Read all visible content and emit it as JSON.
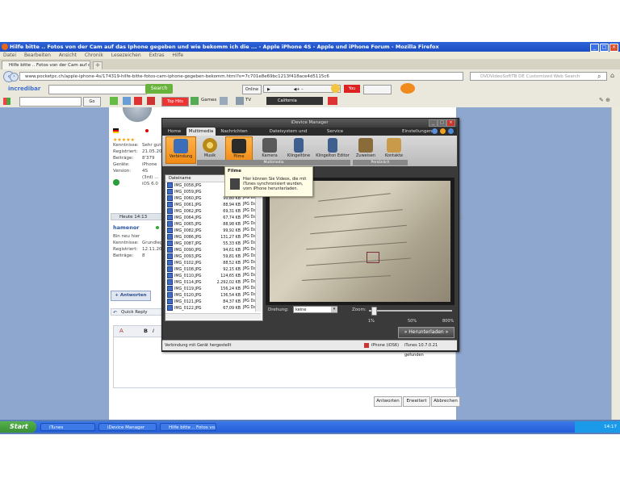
{
  "firefox": {
    "title": "Hilfe bitte .. Fotos von der Cam auf das Iphone gegeben und wie bekomm ich die ... - Apple iPhone 4S - Apple und iPhone Forum - Mozilla Firefox",
    "menu": [
      "Datei",
      "Bearbeiten",
      "Ansicht",
      "Chronik",
      "Lesezeichen",
      "Extras",
      "Hilfe"
    ],
    "tab_label": "Hilfe bitte .. Fotos von der Cam auf das Iph...",
    "url": "www.pocketpc.ch/apple-iphone-4s/174319-hilfe-bitte-fotos-cam-iphone-gegeben-bekomm.html?s=7c701e8e69bc1213f418ace4d5115c6",
    "search_placeholder": "DVDVideoSoftTB DE Customized Web Search",
    "incredibar_label": "incredibar",
    "incredibar_search": "Search",
    "toolbar_items": {
      "top": "Top Hits",
      "games": "Games",
      "tv": "TV",
      "weather": "California"
    }
  },
  "forum": {
    "profile1": {
      "rows": [
        {
          "label": "Kenntnisse:",
          "value": "Sehr gut"
        },
        {
          "label": "Registriert:",
          "value": "21.05.20"
        },
        {
          "label": "Beiträge:",
          "value": "8'379"
        },
        {
          "label": "Geräte:",
          "value": "iPhone 4S"
        },
        {
          "label": "",
          "value": "(3rd) ..."
        },
        {
          "label": "Version:",
          "value": "iOS 6.0"
        }
      ]
    },
    "post_time": "Heute 14:13",
    "username": "hamenor",
    "user_status": "Bin neu hier",
    "profile2": {
      "rows": [
        {
          "label": "Kenntnisse:",
          "value": "Grundleg"
        },
        {
          "label": "Registriert:",
          "value": "12.11.20"
        },
        {
          "label": "Beiträge:",
          "value": "8"
        }
      ]
    },
    "answer_button": "+ Antworten",
    "quick_reply": "Quick Reply",
    "buttons": [
      "Antworten",
      "Erweitert",
      "Abbrechen"
    ]
  },
  "idm": {
    "title": "iDevice Manager",
    "menu": [
      "Home",
      "Multimedia",
      "Nachrichten",
      "Dateisystem und Datenträger",
      "Service"
    ],
    "settings": "Einstellungen",
    "ribbon": [
      "Verbindung",
      "Musik",
      "Filme",
      "Kamera",
      "Klingeltöne",
      "Klingelton Editor",
      "Zuweisen",
      "Kontakte"
    ],
    "group_multimedia": "Multimedia",
    "group_persoenlich": "Persönlich",
    "list_header": "Dateiname",
    "files": [
      {
        "name": "IMG_0058.JPG",
        "size": "10...",
        "type": ""
      },
      {
        "name": "IMG_0059.JPG",
        "size": "7...",
        "type": ""
      },
      {
        "name": "IMG_0060.JPG",
        "size": "90,80 KB",
        "type": "JPG Da"
      },
      {
        "name": "IMG_0061.JPG",
        "size": "88,94 KB",
        "type": "JPG Da"
      },
      {
        "name": "IMG_0062.JPG",
        "size": "69,31 KB",
        "type": "JPG Da"
      },
      {
        "name": "IMG_0064.JPG",
        "size": "67,74 KB",
        "type": "JPG Da"
      },
      {
        "name": "IMG_0065.JPG",
        "size": "88,98 KB",
        "type": "JPG Da"
      },
      {
        "name": "IMG_0082.JPG",
        "size": "99,92 KB",
        "type": "JPG Da"
      },
      {
        "name": "IMG_0086.JPG",
        "size": "131,27 KB",
        "type": "JPG Da"
      },
      {
        "name": "IMG_0087.JPG",
        "size": "55,33 KB",
        "type": "JPG Da"
      },
      {
        "name": "IMG_0090.JPG",
        "size": "94,61 KB",
        "type": "JPG Da"
      },
      {
        "name": "IMG_0093.JPG",
        "size": "59,81 KB",
        "type": "JPG Da"
      },
      {
        "name": "IMG_0102.JPG",
        "size": "88,52 KB",
        "type": "JPG Da"
      },
      {
        "name": "IMG_0108.JPG",
        "size": "92,15 KB",
        "type": "JPG Da"
      },
      {
        "name": "IMG_0110.JPG",
        "size": "124,65 KB",
        "type": "JPG Da"
      },
      {
        "name": "IMG_0114.JPG",
        "size": "2.292,02 KB",
        "type": "JPG Da"
      },
      {
        "name": "IMG_0119.JPG",
        "size": "156,24 KB",
        "type": "JPG Da"
      },
      {
        "name": "IMG_0120.JPG",
        "size": "136,54 KB",
        "type": "JPG Da"
      },
      {
        "name": "IMG_0121.JPG",
        "size": "84,37 KB",
        "type": "JPG Da"
      },
      {
        "name": "IMG_0122.JPG",
        "size": "67,09 KB",
        "type": "JPG Da"
      }
    ],
    "tooltip_title": "Filme",
    "tooltip_text": "Hier können Sie Videos, die mit iTunes synchronisiert wurden, vom iPhone herunterladen.",
    "rotation_label": "Drehung:",
    "rotation_value": "keine",
    "zoom_label": "Zoom:",
    "zoom_percent": 0.05,
    "zoom_ticks": [
      "1%",
      "50%",
      "800%"
    ],
    "download_button": "» Herunterladen »",
    "status_left": "Verbindung mit Gerät hergestellt",
    "status_device": "iPhone (iOS6)",
    "status_itunes": "iTunes 10.7.0.21 gefunden"
  },
  "taskbar": {
    "start": "Start",
    "items": [
      "iTunes",
      "iDevice Manager",
      "Hilfe bitte .. Fotos vo..."
    ],
    "clock": "14:17"
  }
}
